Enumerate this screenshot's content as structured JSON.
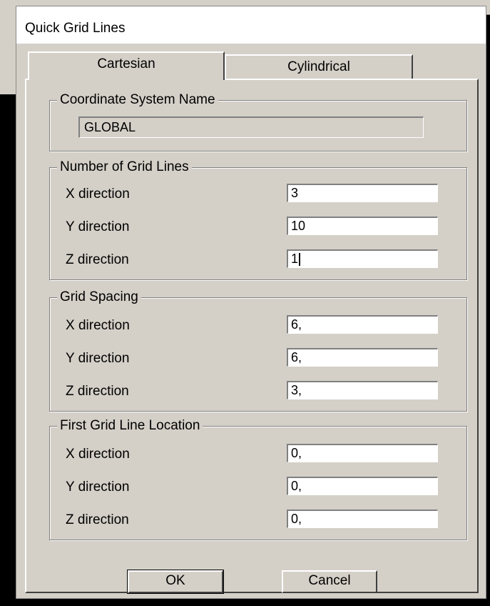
{
  "dialog": {
    "title": "Quick Grid Lines",
    "tabs": [
      {
        "label": "Cartesian",
        "active": true
      },
      {
        "label": "Cylindrical",
        "active": false
      }
    ]
  },
  "coordinate_system": {
    "legend": "Coordinate System Name",
    "value": "GLOBAL"
  },
  "number_of_grid_lines": {
    "legend": "Number of Grid Lines",
    "rows": [
      {
        "label": "X direction",
        "value": "3"
      },
      {
        "label": "Y direction",
        "value": "10"
      },
      {
        "label": "Z direction",
        "value": "1"
      }
    ]
  },
  "grid_spacing": {
    "legend": "Grid Spacing",
    "rows": [
      {
        "label": "X direction",
        "value": "6,"
      },
      {
        "label": "Y direction",
        "value": "6,"
      },
      {
        "label": "Z direction",
        "value": "3,"
      }
    ]
  },
  "first_grid_line_location": {
    "legend": "First Grid Line Location",
    "rows": [
      {
        "label": "X direction",
        "value": "0,"
      },
      {
        "label": "Y direction",
        "value": "0,"
      },
      {
        "label": "Z direction",
        "value": "0,"
      }
    ]
  },
  "buttons": {
    "ok": "OK",
    "cancel": "Cancel"
  }
}
